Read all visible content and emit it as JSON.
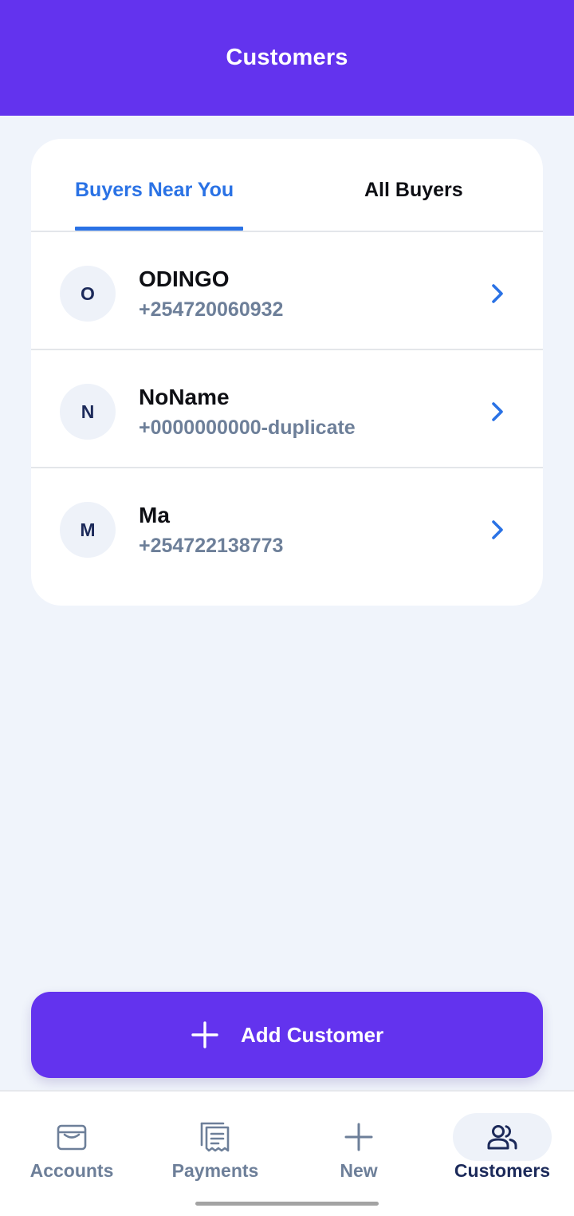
{
  "header": {
    "title": "Customers"
  },
  "tabs": [
    {
      "label": "Buyers Near You",
      "active": true
    },
    {
      "label": "All Buyers",
      "active": false
    }
  ],
  "customers": [
    {
      "initial": "O",
      "name": "ODINGO",
      "phone": "+254720060932"
    },
    {
      "initial": "N",
      "name": "NoName",
      "phone": "+0000000000-duplicate"
    },
    {
      "initial": "M",
      "name": "Ma",
      "phone": "+254722138773"
    }
  ],
  "add_button": {
    "label": "Add Customer",
    "icon": "plus-icon"
  },
  "bottom_nav": [
    {
      "label": "Accounts",
      "icon": "wallet-icon",
      "active": false
    },
    {
      "label": "Payments",
      "icon": "receipt-icon",
      "active": false
    },
    {
      "label": "New",
      "icon": "plus-icon",
      "active": false
    },
    {
      "label": "Customers",
      "icon": "users-icon",
      "active": true
    }
  ],
  "colors": {
    "brand": "#6333EE",
    "accent": "#2A72E5",
    "background": "#F0F4FB",
    "muted_text": "#6D7F99",
    "dark_text": "#1C2A5A"
  }
}
